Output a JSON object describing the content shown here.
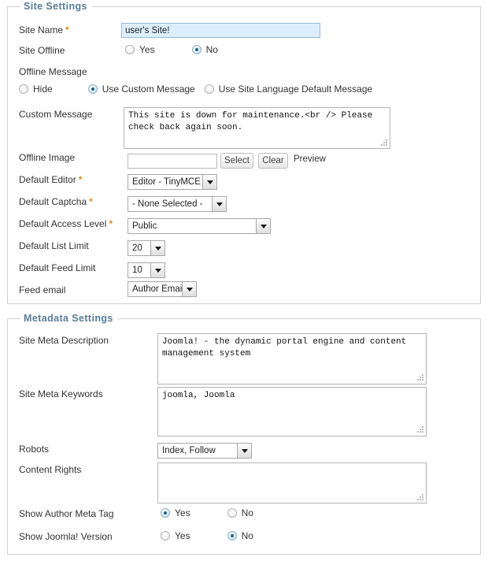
{
  "site_settings": {
    "legend": "Site Settings",
    "site_name": {
      "label": "Site Name",
      "required": "*",
      "value": "user's Site!"
    },
    "site_offline": {
      "label": "Site Offline",
      "options": [
        "Yes",
        "No"
      ],
      "selected": "No"
    },
    "offline_message_mode": {
      "label": "Offline Message",
      "options": [
        "Hide",
        "Use Custom Message",
        "Use Site Language Default Message"
      ],
      "selected": "Use Custom Message"
    },
    "custom_message": {
      "label": "Custom Message",
      "value": "This site is down for maintenance.<br /> Please check back again soon."
    },
    "offline_image": {
      "label": "Offline Image",
      "value": "",
      "select_button": "Select",
      "clear_button": "Clear",
      "preview_label": "Preview"
    },
    "default_editor": {
      "label": "Default Editor",
      "required": "*",
      "selected": "Editor - TinyMCE"
    },
    "default_captcha": {
      "label": "Default Captcha",
      "required": "*",
      "selected": "- None Selected -"
    },
    "default_access_level": {
      "label": "Default Access Level",
      "required": "*",
      "selected": "Public"
    },
    "default_list_limit": {
      "label": "Default List Limit",
      "selected": "20"
    },
    "default_feed_limit": {
      "label": "Default Feed Limit",
      "selected": "10"
    },
    "feed_email": {
      "label": "Feed email",
      "selected": "Author Email"
    }
  },
  "metadata_settings": {
    "legend": "Metadata Settings",
    "site_meta_description": {
      "label": "Site Meta Description",
      "value": "Joomla! - the dynamic portal engine and content management system"
    },
    "site_meta_keywords": {
      "label": "Site Meta Keywords",
      "value": "joomla, Joomla"
    },
    "robots": {
      "label": "Robots",
      "selected": "Index, Follow"
    },
    "content_rights": {
      "label": "Content Rights",
      "value": ""
    },
    "show_author_meta_tag": {
      "label": "Show Author Meta Tag",
      "options": [
        "Yes",
        "No"
      ],
      "selected": "Yes"
    },
    "show_joomla_version": {
      "label": "Show Joomla! Version",
      "options": [
        "Yes",
        "No"
      ],
      "selected": "No"
    }
  },
  "colors": {
    "legend_text": "#5a7c96",
    "required_marker": "#e08b1b",
    "focus_field_bg": "#ddeefc",
    "radio_dot": "#2a5d82",
    "panel_border": "#cfcfcf"
  }
}
